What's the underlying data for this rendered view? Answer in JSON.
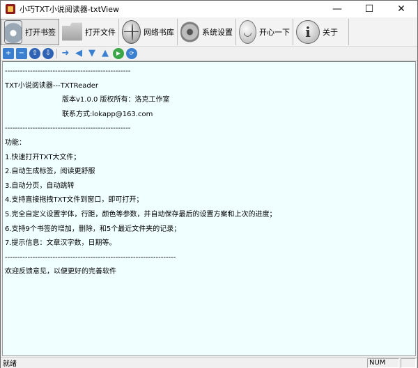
{
  "window": {
    "title": "小巧TXT小说阅读器-txtView"
  },
  "titlebar": {
    "minimize": "—",
    "maximize": "☐",
    "close": "✕"
  },
  "toolbar": {
    "buttons": [
      {
        "label": "打开书签",
        "icon": "cd-bookmark-icon"
      },
      {
        "label": "打开文件",
        "icon": "folder-icon"
      },
      {
        "label": "网络书库",
        "icon": "globe-icon"
      },
      {
        "label": "系统设置",
        "icon": "gear-icon"
      },
      {
        "label": "开心一下",
        "icon": "smiley-icon"
      },
      {
        "label": "关于",
        "icon": "info-icon",
        "glyph": "i"
      }
    ]
  },
  "small_toolbar": {
    "icons": [
      "add-bookmark-icon",
      "delete-bookmark-icon",
      "prev-bookmark-icon",
      "next-bookmark-icon",
      "arrow-right-icon",
      "arrow-left-icon",
      "arrow-down-icon",
      "arrow-up-icon",
      "play-icon",
      "refresh-icon"
    ]
  },
  "content": {
    "lines": [
      "--------------------------------------------------",
      "TXT小说阅读器---TXTReader",
      "版本v1.0.0 版权所有：洛克工作室",
      "联系方式:lokapp@163.com",
      "--------------------------------------------------",
      "功能：",
      "1.快速打开TXT大文件；",
      "2.自动生成标签，阅读更舒服",
      "3.自动分页，自动跳转",
      "4.支持直接拖拽TXT文件到窗口，即可打开；",
      "5.完全自定义设置字体，行距，颜色等参数，并自动保存最后的设置方案和上次的进度；",
      "6.支持9个书签的增加，删除，和5个最近文件夹的记录；",
      "7.提示信息：文章汉字数，日期等。",
      "--------------------------------------------------------------------",
      "欢迎反馈意见，以便更好的完善软件"
    ]
  },
  "statusbar": {
    "text": "就绪",
    "num": "NUM"
  },
  "colors": {
    "content_bg": "#f0ffff",
    "window_bg": "#f0f0f0"
  }
}
